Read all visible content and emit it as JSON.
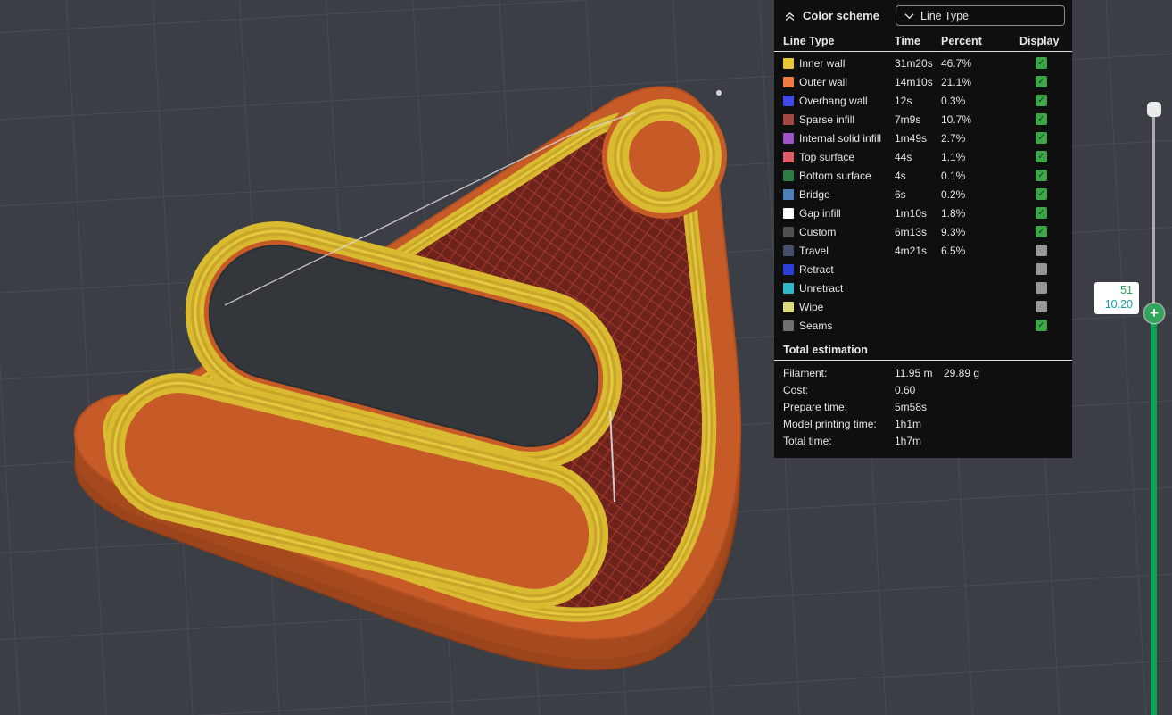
{
  "viewport": {
    "background": "#3b3e44",
    "grid_color": "#4a4d53",
    "model": {
      "outer_wall_color": "#c65b28",
      "inner_wall_color": "#d9ba30",
      "sparse_infill_color": "#6e221c",
      "side_color": "#a64a1e"
    }
  },
  "color_scheme_panel": {
    "title": "Color scheme",
    "view_type_dropdown": {
      "selected": "Line Type"
    },
    "table": {
      "headers": {
        "line_type": "Line Type",
        "time": "Time",
        "percent": "Percent",
        "display": "Display"
      },
      "rows": [
        {
          "label": "Inner wall",
          "swatch": "#e9c637",
          "time": "31m20s",
          "percent": "46.7%",
          "display": true
        },
        {
          "label": "Outer wall",
          "swatch": "#ed7e41",
          "time": "14m10s",
          "percent": "21.1%",
          "display": true
        },
        {
          "label": "Overhang wall",
          "swatch": "#3f48e8",
          "time": "12s",
          "percent": "0.3%",
          "display": true
        },
        {
          "label": "Sparse infill",
          "swatch": "#a34741",
          "time": "7m9s",
          "percent": "10.7%",
          "display": true
        },
        {
          "label": "Internal solid infill",
          "swatch": "#9e54c7",
          "time": "1m49s",
          "percent": "2.7%",
          "display": true
        },
        {
          "label": "Top surface",
          "swatch": "#e15c63",
          "time": "44s",
          "percent": "1.1%",
          "display": true
        },
        {
          "label": "Bottom surface",
          "swatch": "#2e7d46",
          "time": "4s",
          "percent": "0.1%",
          "display": true
        },
        {
          "label": "Bridge",
          "swatch": "#4d80ba",
          "time": "6s",
          "percent": "0.2%",
          "display": true
        },
        {
          "label": "Gap infill",
          "swatch": "#ffffff",
          "time": "1m10s",
          "percent": "1.8%",
          "display": true
        },
        {
          "label": "Custom",
          "swatch": "#4f4f4f",
          "time": "6m13s",
          "percent": "9.3%",
          "display": true
        },
        {
          "label": "Travel",
          "swatch": "#44506b",
          "time": "4m21s",
          "percent": "6.5%",
          "display": false
        },
        {
          "label": "Retract",
          "swatch": "#2a3fd4",
          "time": "",
          "percent": "",
          "display": false
        },
        {
          "label": "Unretract",
          "swatch": "#30b7c8",
          "time": "",
          "percent": "",
          "display": false
        },
        {
          "label": "Wipe",
          "swatch": "#dada7a",
          "time": "",
          "percent": "",
          "display": false
        },
        {
          "label": "Seams",
          "swatch": "#6f6f6f",
          "time": "",
          "percent": "",
          "display": true
        }
      ]
    },
    "total_estimation": {
      "title": "Total estimation",
      "rows": [
        {
          "label": "Filament:",
          "value": "11.95 m",
          "value2": "29.89 g"
        },
        {
          "label": "Cost:",
          "value": "0.60",
          "value2": ""
        },
        {
          "label": "Prepare time:",
          "value": "5m58s",
          "value2": ""
        },
        {
          "label": "Model printing time:",
          "value": "1h1m",
          "value2": ""
        },
        {
          "label": "Total time:",
          "value": "1h7m",
          "value2": ""
        }
      ]
    }
  },
  "layer_slider": {
    "current_layer": "51",
    "current_height": "10.20",
    "accent_green": "#10a254",
    "plus_icon": "+"
  }
}
